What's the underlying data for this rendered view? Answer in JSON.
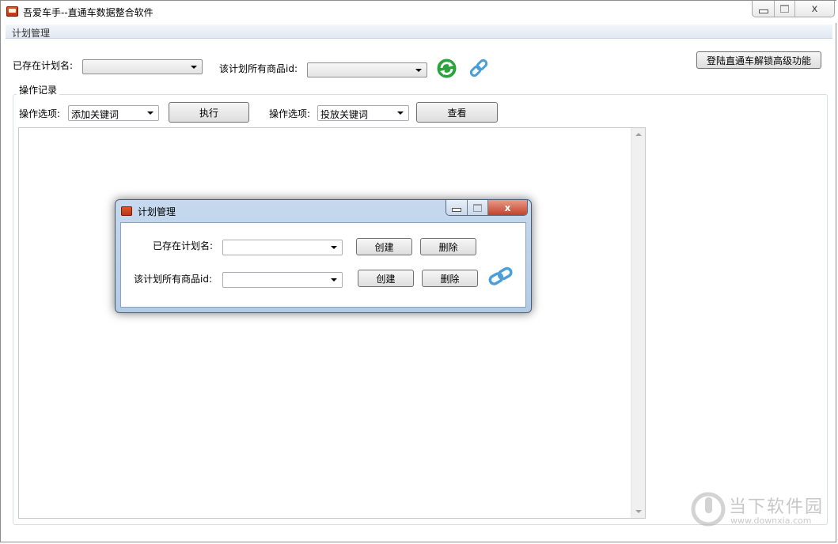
{
  "window": {
    "title": "吾爱车手--直通车数据整合软件",
    "caption_close": "x"
  },
  "menu": {
    "items": [
      "计划管理"
    ]
  },
  "top": {
    "plan_name_label": "已存在计划名:",
    "plan_name_value": "",
    "product_id_label": "该计划所有商品id:",
    "product_id_value": "",
    "refresh_icon": "refresh-icon",
    "link_icon": "link-icon",
    "unlock_button": "登陆直通车解锁高级功能"
  },
  "log": {
    "group_title": "操作记录",
    "option1_label": "操作选项:",
    "option1_value": "添加关键词",
    "execute_button": "执行",
    "option2_label": "操作选项:",
    "option2_value": "投放关键词",
    "view_button": "查看",
    "content": ""
  },
  "dialog": {
    "title": "计划管理",
    "caption_close": "x",
    "plan_name_label": "已存在计划名:",
    "plan_name_value": "",
    "create_button_1": "创建",
    "delete_button_1": "删除",
    "product_id_label": "该计划所有商品id:",
    "product_id_value": "",
    "create_button_2": "创建",
    "delete_button_2": "删除"
  },
  "watermark": {
    "text": "当下软件园",
    "url": "www.downxia.com"
  },
  "colors": {
    "refresh_green": "#2aa33a",
    "link_blue": "#4a9fd8",
    "dialog_frame": "#b9d0e8"
  }
}
